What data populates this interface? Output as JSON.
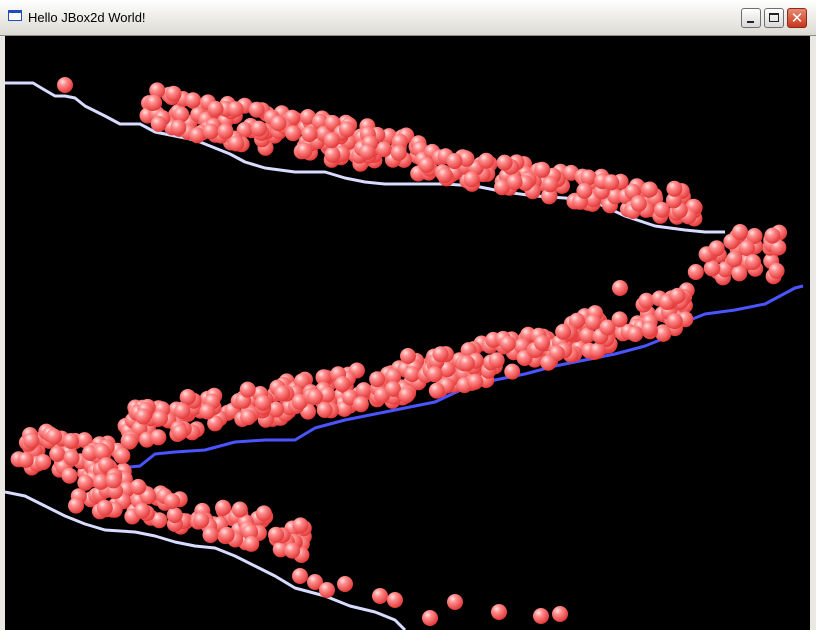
{
  "window": {
    "title": "Hello JBox2d World!",
    "icon": "app-window-icon",
    "controls": [
      "minimize-icon",
      "maximize-icon",
      "close-icon"
    ]
  },
  "scene": {
    "background": "#000000",
    "ball_color": "#ff6b6b",
    "ball_highlight": "#ffd4d4",
    "terrain_color_light": "#d8dcff",
    "terrain_color_dark": "#4a55ff"
  }
}
